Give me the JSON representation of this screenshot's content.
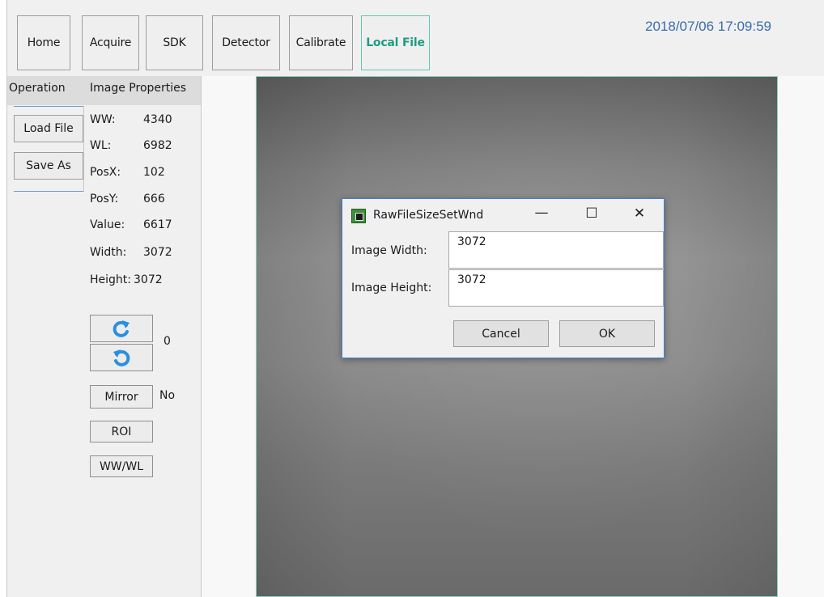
{
  "nav": {
    "home": "Home",
    "acquire": "Acquire",
    "sdk": "SDK",
    "detector": "Detector",
    "calibrate": "Calibrate",
    "local_file": "Local File"
  },
  "datetime": "2018/07/06 17:09:59",
  "left_panel": {
    "tabs": {
      "operation": "Operation",
      "image_properties": "Image Properties"
    },
    "buttons": {
      "load_file": "Load File",
      "save_as": "Save As"
    },
    "properties": [
      {
        "label": "WW:",
        "value": "4340"
      },
      {
        "label": "WL:",
        "value": "6982"
      },
      {
        "label": "PosX:",
        "value": "102"
      },
      {
        "label": "PosY:",
        "value": "666"
      },
      {
        "label": "Value:",
        "value": "6617"
      },
      {
        "label": "Width:",
        "value": "3072"
      },
      {
        "label": "Height:",
        "value": "3072"
      }
    ],
    "rotation_value": "0",
    "mirror_label": "Mirror",
    "mirror_value": "No",
    "roi_label": "ROI",
    "wwwl_label": "WW/WL",
    "rotate_cw_icon": "rotate-clockwise-icon",
    "rotate_ccw_icon": "rotate-counterclockwise-icon"
  },
  "dialog": {
    "title": "RawFileSizeSetWnd",
    "minimize": "—",
    "maximize": "☐",
    "close": "✕",
    "width_label": "Image Width:",
    "width_value": "3072",
    "height_label": "Image Height:",
    "height_value": "3072",
    "cancel": "Cancel",
    "ok": "OK"
  },
  "colors": {
    "accent": "#1f9b84",
    "datetime": "#3b6cb0",
    "dialog_border": "#3c7fd6",
    "icon_blue": "#2a8fe0"
  }
}
